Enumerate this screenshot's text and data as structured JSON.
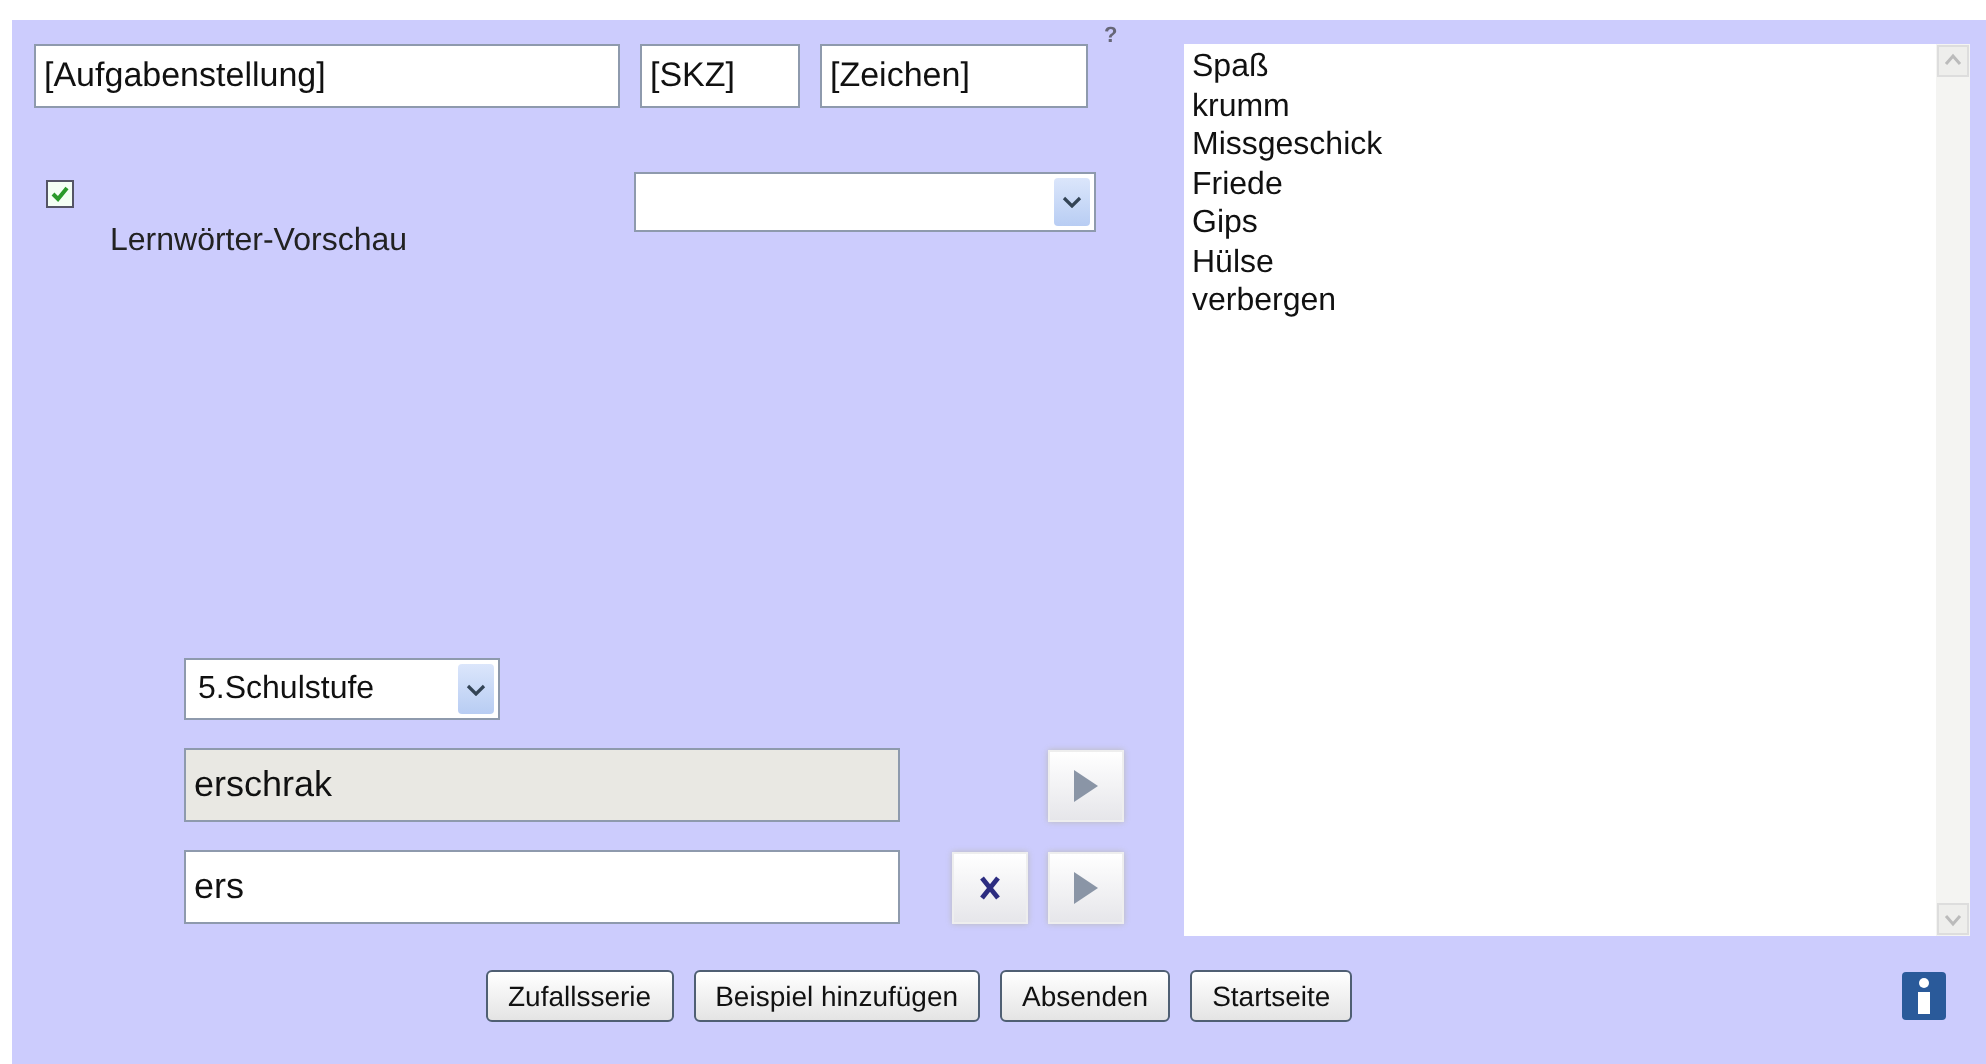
{
  "header_fields": [
    {
      "value": "[Aufgabenstellung]"
    },
    {
      "value": "[SKZ]"
    },
    {
      "value": "[Zeichen]"
    }
  ],
  "help_mark": "?",
  "preview": {
    "label": "Lernwörter-Vorschau",
    "checked": true
  },
  "grade_select": {
    "value": "5.Schulstufe"
  },
  "solution_field": {
    "value": "erschrak"
  },
  "answer_field": {
    "value": "ers"
  },
  "word_list": [
    "Spaß",
    "krumm",
    "Missgeschick",
    "Friede",
    "Gips",
    "Hülse",
    "verbergen"
  ],
  "buttons": [
    "Zufallsserie",
    "Beispiel hinzufügen",
    "Absenden",
    "Startseite"
  ]
}
